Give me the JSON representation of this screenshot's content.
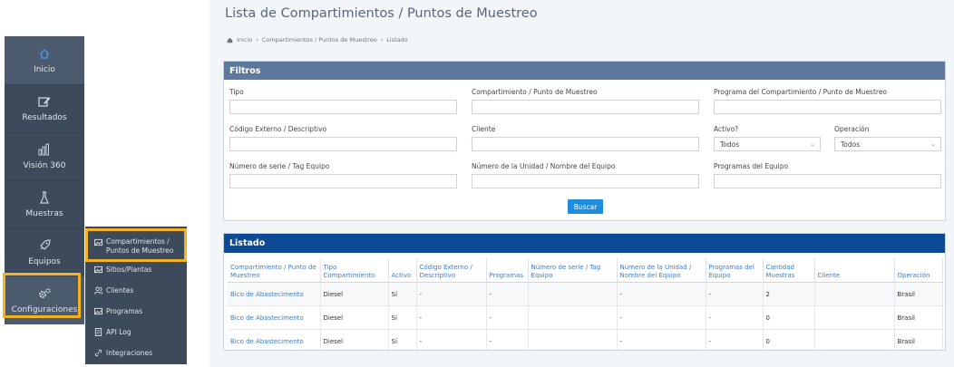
{
  "sidebar": {
    "items": [
      {
        "label": "Inicio",
        "icon": "home-icon"
      },
      {
        "label": "Resultados",
        "icon": "edit-icon"
      },
      {
        "label": "Visión 360",
        "icon": "bar-chart-icon"
      },
      {
        "label": "Muestras",
        "icon": "flask-icon"
      },
      {
        "label": "Equipos",
        "icon": "rocket-icon"
      },
      {
        "label": "Configuraciones",
        "icon": "gears-icon"
      }
    ]
  },
  "submenu": {
    "items": [
      {
        "label_line1": "Compartimientos /",
        "label_line2": "Puntos de Muestreo",
        "icon": "image-icon"
      },
      {
        "label": "Sitios/Plantas",
        "icon": "image-icon"
      },
      {
        "label": "Clientes",
        "icon": "users-icon"
      },
      {
        "label": "Programas",
        "icon": "image-icon"
      },
      {
        "label": "API Log",
        "icon": "doc-icon"
      },
      {
        "label": "Integraciones",
        "icon": "link-icon"
      }
    ]
  },
  "page": {
    "title": "Lista de Compartimientos / Puntos de Muestreo",
    "breadcrumb": [
      "Inicio",
      "Compartimientos / Puntos de Muestreo",
      "Listado"
    ]
  },
  "filters": {
    "title": "Filtros",
    "tipo_label": "Tipo",
    "tipo_value": "",
    "compartimiento_label": "Compartimiento / Punto de Muestreo",
    "compartimiento_value": "",
    "programa_label": "Programa del Compartimiento / Punto de Muestreo",
    "programa_value": "",
    "codigo_label": "Código Externo / Descriptivo",
    "codigo_value": "",
    "cliente_label": "Cliente",
    "cliente_value": "",
    "activo_label": "Activo?",
    "activo_value": "Todos",
    "operacion_label": "Operación",
    "operacion_value": "Todos",
    "serie_label": "Número de serie / Tag Equipo",
    "serie_value": "",
    "unidad_label": "Número de la Unidad / Nombre del Equipo",
    "unidad_value": "",
    "programas_equipo_label": "Programas del Equipo",
    "programas_equipo_value": "",
    "search_button": "Buscar"
  },
  "listado": {
    "title": "Listado",
    "columns": [
      "Compartimiento / Punto de Muestreo",
      "Tipo Compartimiento",
      "Activo",
      "Código Externo / Descriptivo",
      "Programas",
      "Número de serie / Tag Equipo",
      "Número de la Unidad / Nombre del Equipo",
      "Programas del Equipo",
      "Cantidad Muestras",
      "Cliente",
      "Operación"
    ],
    "rows": [
      [
        "Bico de Abastecimento",
        "Diesel",
        "Sí",
        "-",
        "-",
        "",
        "-",
        "-",
        "2",
        "",
        "Brasil"
      ],
      [
        "Bico de Abastecimento",
        "Diesel",
        "Sí",
        "-",
        "-",
        "",
        "-",
        "-",
        "0",
        "",
        "Brasil"
      ],
      [
        "Bico de Abastecimento",
        "Diesel",
        "Sí",
        "-",
        "-",
        "",
        "-",
        "-",
        "0",
        "",
        "Brasil"
      ]
    ]
  },
  "colors": {
    "sidebar_bg": "#3c4a5c",
    "highlight": "#f5b41e",
    "filters_header": "#5d7a9e",
    "listado_header": "#0d4a96",
    "button": "#1e8de0",
    "link": "#3b7dc4"
  }
}
